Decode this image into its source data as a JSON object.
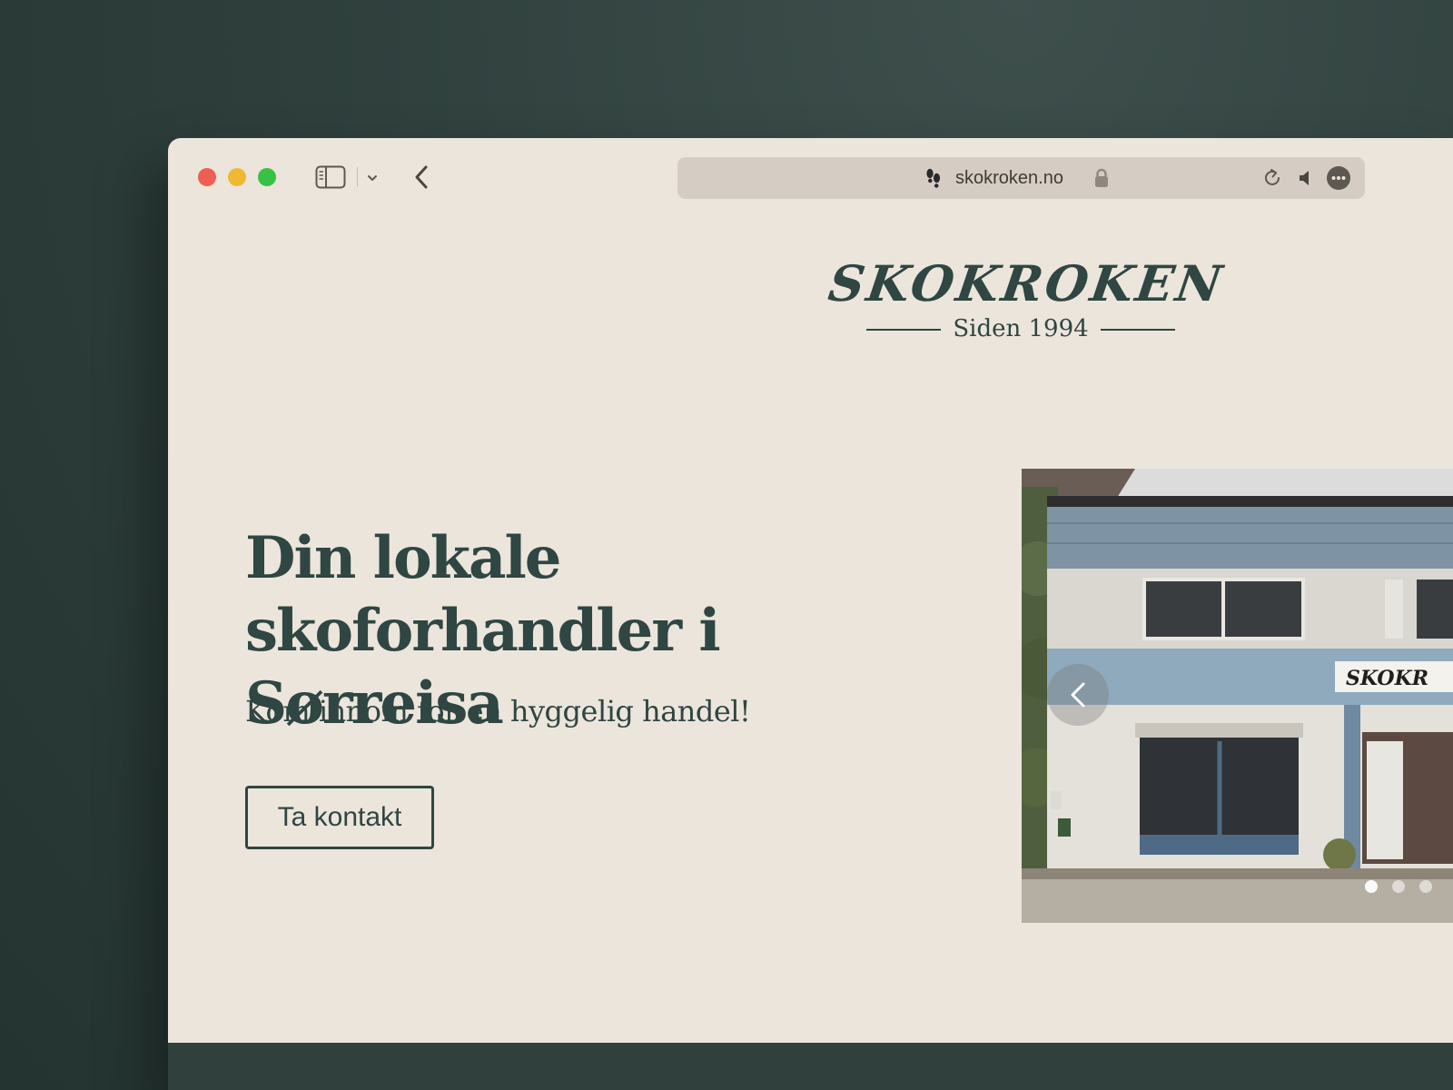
{
  "browser": {
    "url": "skokroken.no"
  },
  "header": {
    "logo": "SKOKROKEN",
    "since": "Siden 1994"
  },
  "hero": {
    "headline_line1": "Din lokale skoforhandler i",
    "headline_line2": "Sørreisa",
    "subheadline": "Kom innom for en hyggelig handel!",
    "cta_label": "Ta kontakt",
    "sign_text": "SKOKR"
  },
  "carousel": {
    "slide_count": 3,
    "active_slide": 1
  },
  "colors": {
    "brand": "#2f4642",
    "page_background": "#ece5dc",
    "backdrop": "#2f403d"
  },
  "icons": [
    "sidebar-icon",
    "chevron-down-icon",
    "back-chevron-icon",
    "footprints-icon",
    "lock-icon",
    "reload-icon",
    "speaker-icon",
    "more-icon",
    "carousel-prev-icon"
  ]
}
